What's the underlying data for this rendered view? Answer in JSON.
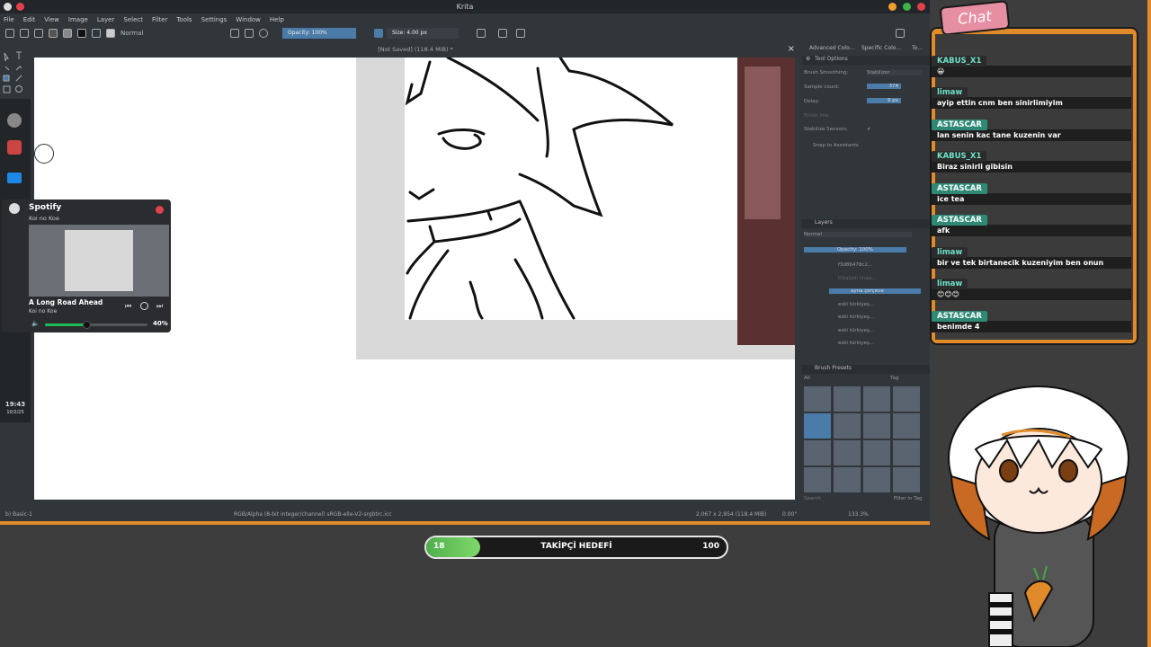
{
  "app_title": "Krita",
  "menu": [
    "File",
    "Edit",
    "View",
    "Image",
    "Layer",
    "Select",
    "Filter",
    "Tools",
    "Settings",
    "Window",
    "Help"
  ],
  "toolbar": {
    "blend_mode": "Normal",
    "opacity": "Opacity: 100%",
    "size": "Size: 4.00 px"
  },
  "doc_title": "[Not Saved]  (118.4 MiB) *",
  "dock": {
    "tabs": [
      "Advanced Colo...",
      "Specific Colo...",
      "To..."
    ],
    "tool_options_title": "Tool Options",
    "brush_smoothing_label": "Brush Smoothing:",
    "brush_smoothing_value": "Stabilizer",
    "sample_count_label": "Sample count:",
    "sample_count_value": "374",
    "delay_label": "Delay:",
    "delay_value": "9 px",
    "finish_line_label": "Finish line:",
    "stabilize_sensors_label": "Stabilize Sensors:",
    "snap_label": "Snap to Assistants",
    "layers_title": "Layers",
    "layers_blend": "Normal",
    "layers_opacity": "Opacity: 100%",
    "layers": [
      "f3d86478c2...",
      "tilkalum linea...",
      "ayna çerçeve",
      "eski türkiyeş...",
      "eski türkiyeş...",
      "eski türkiyeş...",
      "eski türkiyeş..."
    ],
    "brush_presets_title": "Brush Presets",
    "brush_filter": "All",
    "tag_label": "Tag",
    "search_placeholder": "Search",
    "filter_in_tag": "Filter in Tag"
  },
  "status": {
    "brush": "b) Basic-1",
    "color": "RGB/Alpha (8-bit integer/channel)  sRGB-elle-V2-srgbtrc.icc",
    "dims": "2,067 x 2,954 (118.4 MiB)",
    "rotation": "0.00°",
    "zoom": "133.3%"
  },
  "clock": {
    "time": "19:43",
    "date": "10/2/25"
  },
  "spotify": {
    "app": "Spotify",
    "artist_top": "Koi no Koe",
    "track": "A Long Road Ahead",
    "artist": "Koi no Koe",
    "volume_label": "40%",
    "volume_fraction": 0.4
  },
  "goal": {
    "current": "18",
    "label": "TAKİPÇİ HEDEFİ",
    "target": "100",
    "current_value": 18,
    "target_value": 100
  },
  "chat": {
    "title": "Chat",
    "messages": [
      {
        "user": "KABUS_X1",
        "text": "😀"
      },
      {
        "user": "limaw",
        "text": "ayip ettin cnm ben sinirlimiyim"
      },
      {
        "user": "ASTASCAR",
        "text": "lan senin kac tane kuzenin var"
      },
      {
        "user": "KABUS_X1",
        "text": "Biraz sinirli gibisin"
      },
      {
        "user": "ASTASCAR",
        "text": "ice tea"
      },
      {
        "user": "ASTASCAR",
        "text": "afk"
      },
      {
        "user": "limaw",
        "text": "bir ve tek birtanecik kuzeniyim ben onun"
      },
      {
        "user": "limaw",
        "text": "😊😊😊"
      },
      {
        "user": "ASTASCAR",
        "text": "benimde 4"
      }
    ]
  },
  "colors": {
    "accent": "#e08a2a",
    "goal_green": "#5cc24f",
    "krita_bg": "#31363b",
    "selection": "#4b7ba8"
  }
}
